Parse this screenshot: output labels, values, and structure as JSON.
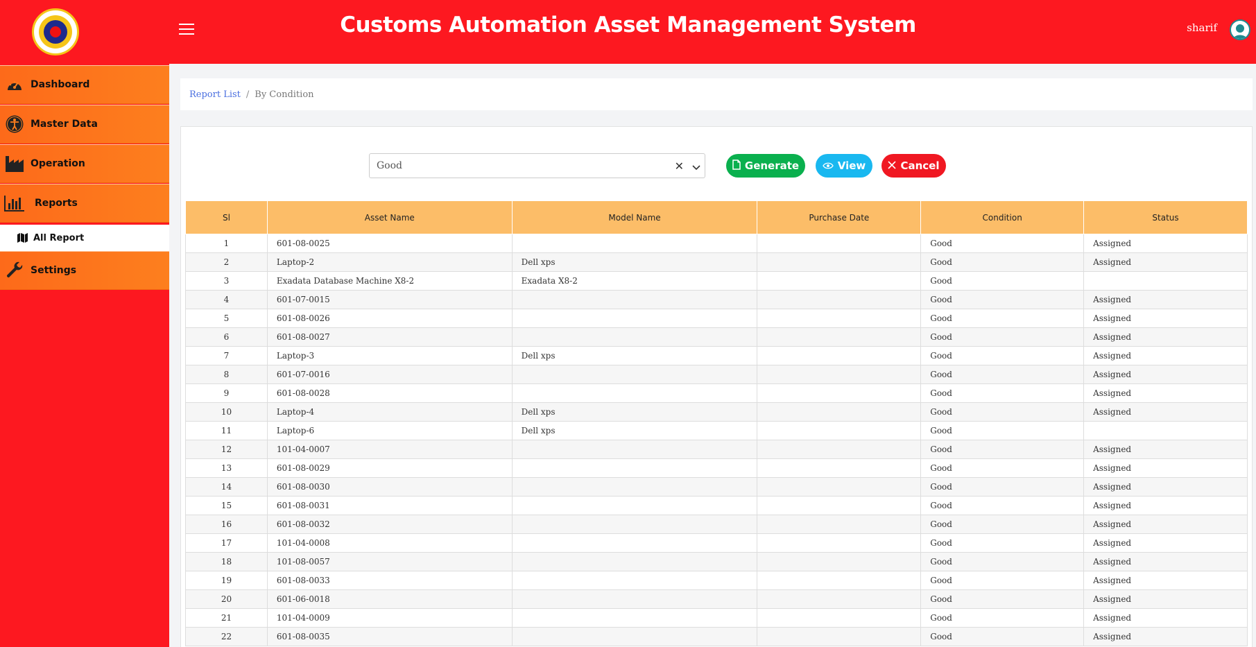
{
  "header": {
    "title": "Customs Automation Asset Management System",
    "username": "sharif"
  },
  "sidebar": {
    "items": [
      {
        "label": "Dashboard",
        "icon": "dashboard-gauge-icon"
      },
      {
        "label": "Master Data",
        "icon": "accessibility-icon"
      },
      {
        "label": "Operation",
        "icon": "factory-icon"
      },
      {
        "label": "Reports",
        "icon": "bar-chart-icon"
      },
      {
        "label": "Settings",
        "icon": "wrench-icon"
      }
    ],
    "sub_item": {
      "label": "All Report",
      "icon": "map-icon"
    }
  },
  "breadcrumb": {
    "link": "Report List",
    "separator": "/",
    "current": "By Condition"
  },
  "filter": {
    "selected_value": "Good",
    "clear_glyph": "✕"
  },
  "buttons": {
    "generate": "Generate",
    "view": "View",
    "cancel": "Cancel"
  },
  "colors": {
    "header_bg": "#fd1820",
    "nav_bg": "#fd7f1e",
    "table_header_bg": "#fcbd68",
    "generate_btn": "#0ab04e",
    "view_btn": "#19b8f0",
    "cancel_btn": "#f01822"
  },
  "table": {
    "columns": [
      "Sl",
      "Asset Name",
      "Model Name",
      "Purchase Date",
      "Condition",
      "Status"
    ],
    "rows": [
      [
        "1",
        "601-08-0025",
        "",
        "",
        "Good",
        "Assigned"
      ],
      [
        "2",
        "Laptop-2",
        "Dell xps",
        "",
        "Good",
        "Assigned"
      ],
      [
        "3",
        "Exadata Database Machine X8-2",
        "Exadata X8-2",
        "",
        "Good",
        ""
      ],
      [
        "4",
        "601-07-0015",
        "",
        "",
        "Good",
        "Assigned"
      ],
      [
        "5",
        "601-08-0026",
        "",
        "",
        "Good",
        "Assigned"
      ],
      [
        "6",
        "601-08-0027",
        "",
        "",
        "Good",
        "Assigned"
      ],
      [
        "7",
        "Laptop-3",
        "Dell xps",
        "",
        "Good",
        "Assigned"
      ],
      [
        "8",
        "601-07-0016",
        "",
        "",
        "Good",
        "Assigned"
      ],
      [
        "9",
        "601-08-0028",
        "",
        "",
        "Good",
        "Assigned"
      ],
      [
        "10",
        "Laptop-4",
        "Dell xps",
        "",
        "Good",
        "Assigned"
      ],
      [
        "11",
        "Laptop-6",
        "Dell xps",
        "",
        "Good",
        ""
      ],
      [
        "12",
        "101-04-0007",
        "",
        "",
        "Good",
        "Assigned"
      ],
      [
        "13",
        "601-08-0029",
        "",
        "",
        "Good",
        "Assigned"
      ],
      [
        "14",
        "601-08-0030",
        "",
        "",
        "Good",
        "Assigned"
      ],
      [
        "15",
        "601-08-0031",
        "",
        "",
        "Good",
        "Assigned"
      ],
      [
        "16",
        "601-08-0032",
        "",
        "",
        "Good",
        "Assigned"
      ],
      [
        "17",
        "101-04-0008",
        "",
        "",
        "Good",
        "Assigned"
      ],
      [
        "18",
        "101-08-0057",
        "",
        "",
        "Good",
        "Assigned"
      ],
      [
        "19",
        "601-08-0033",
        "",
        "",
        "Good",
        "Assigned"
      ],
      [
        "20",
        "601-06-0018",
        "",
        "",
        "Good",
        "Assigned"
      ],
      [
        "21",
        "101-04-0009",
        "",
        "",
        "Good",
        "Assigned"
      ],
      [
        "22",
        "601-08-0035",
        "",
        "",
        "Good",
        "Assigned"
      ]
    ]
  }
}
